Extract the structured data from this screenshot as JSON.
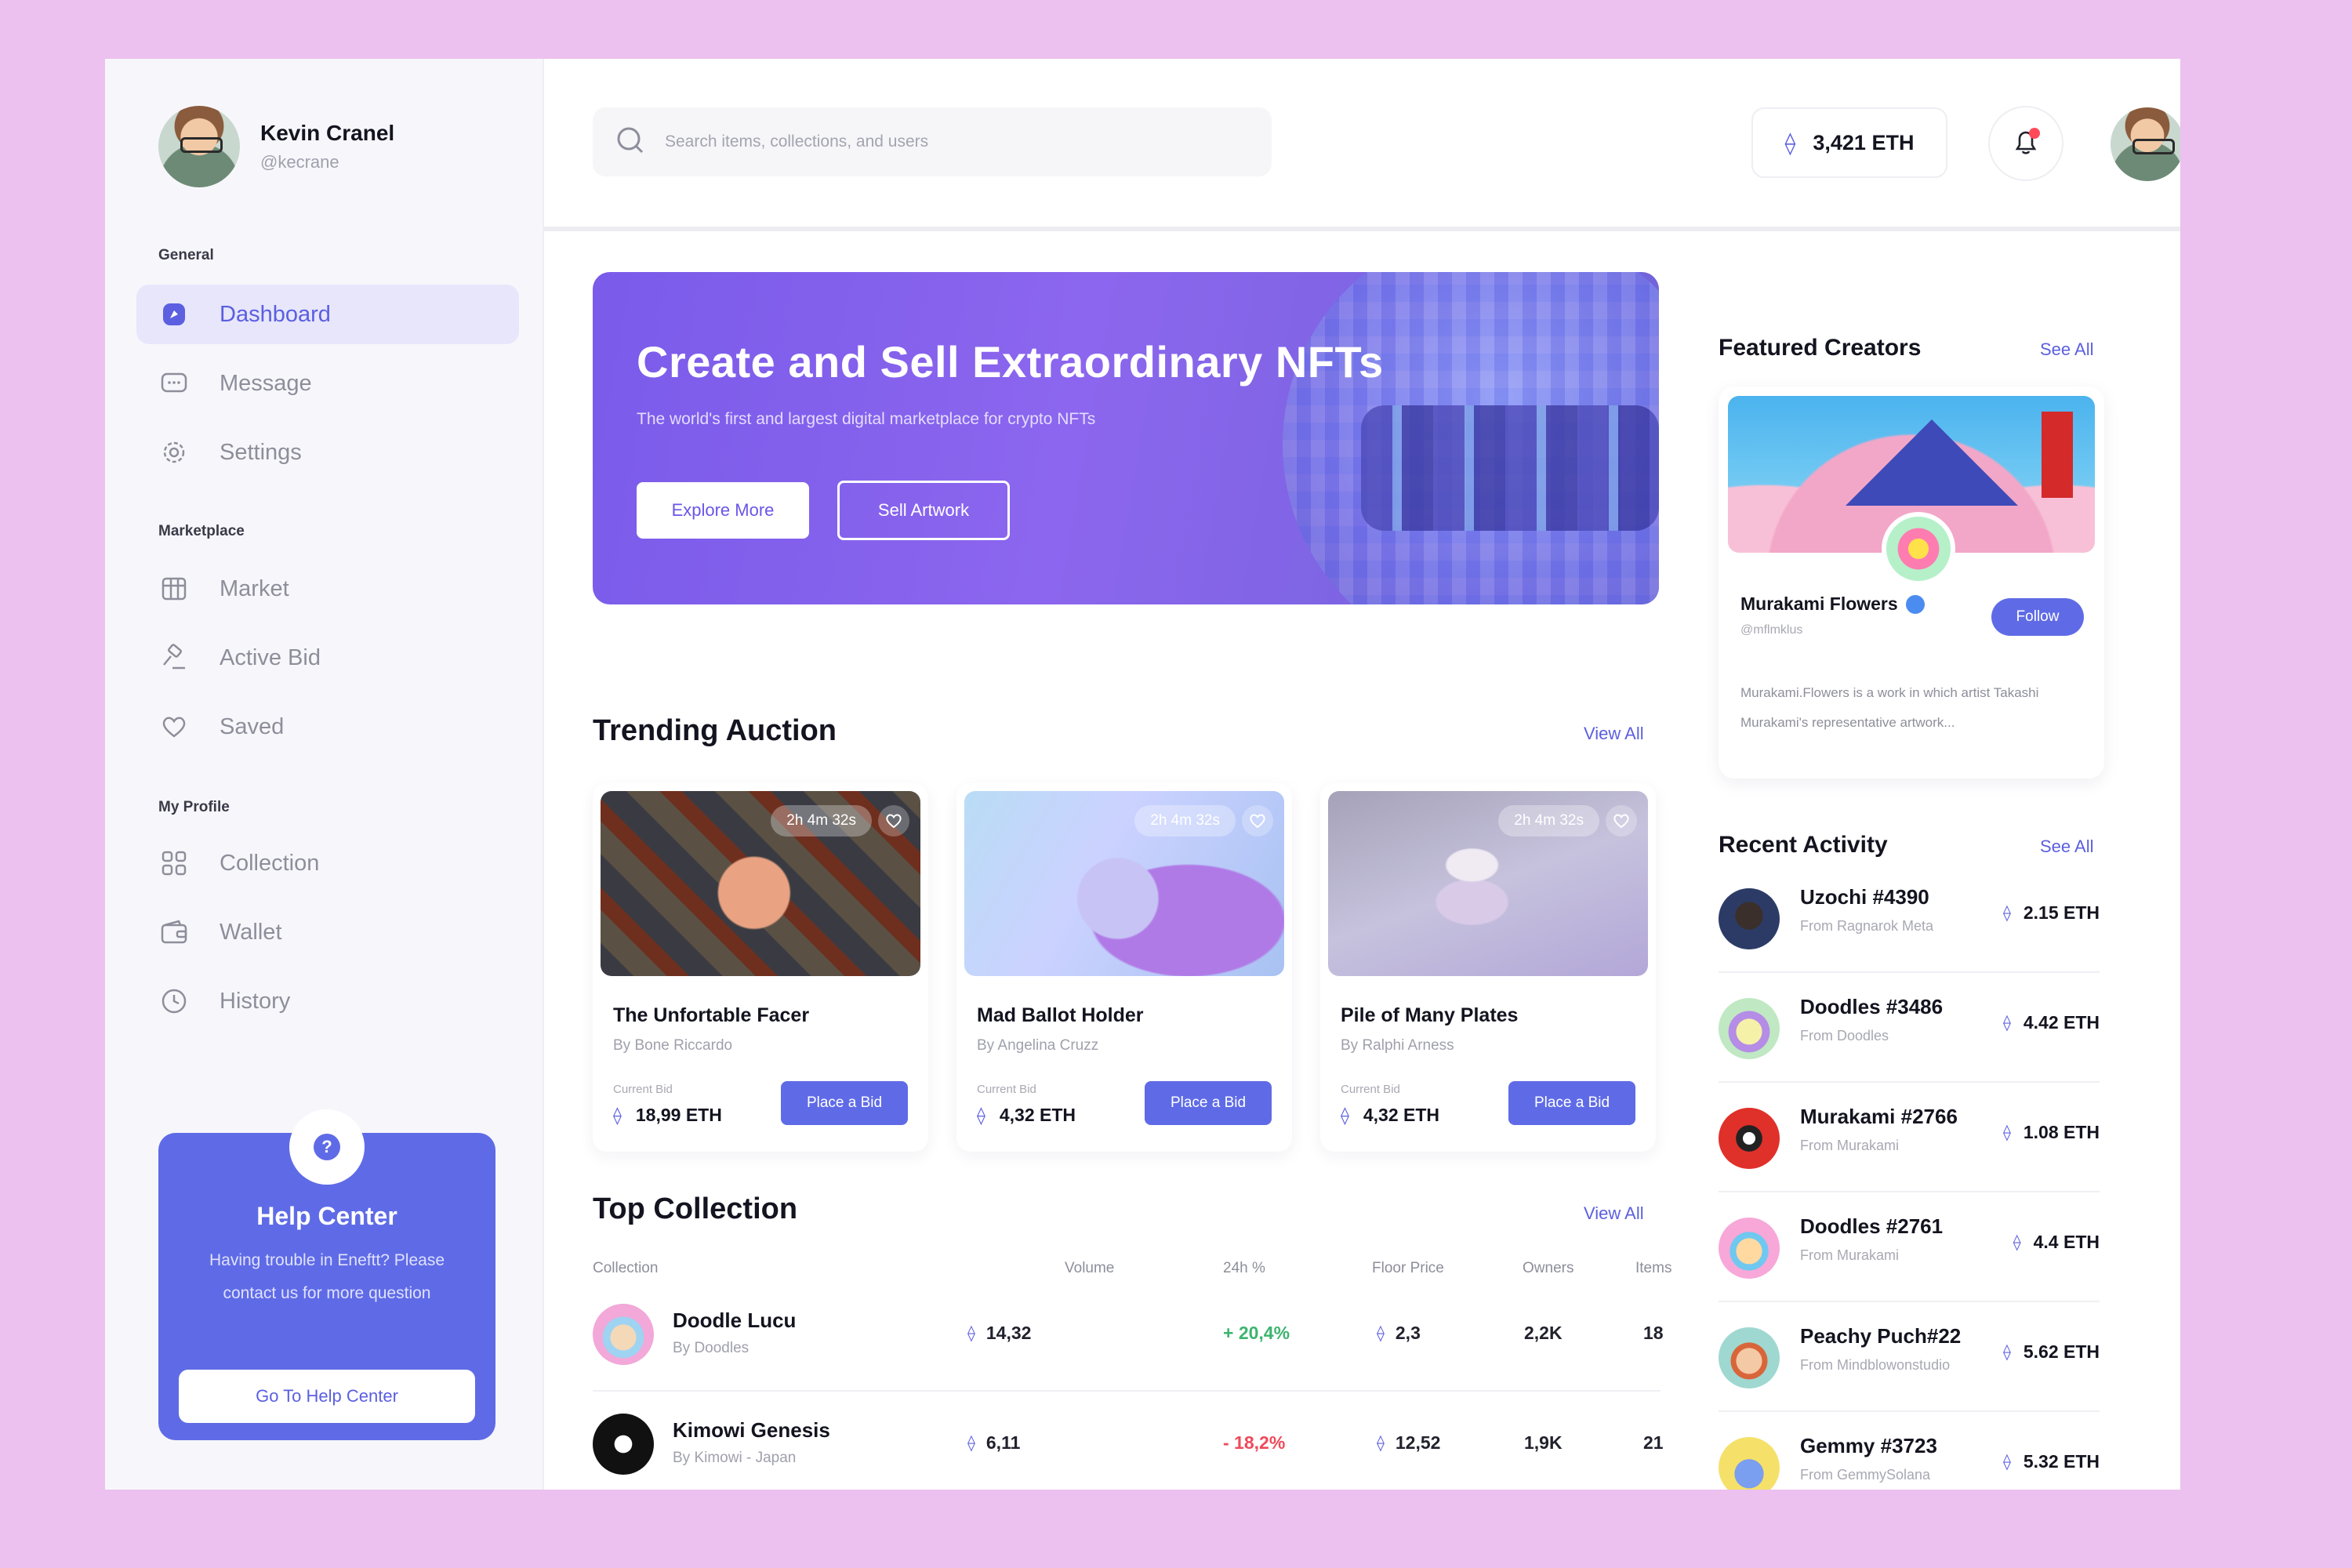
{
  "user": {
    "name": "Kevin Cranel",
    "handle": "@kecrane"
  },
  "sidebar": {
    "sections": [
      "General",
      "Marketplace",
      "My Profile"
    ],
    "items": [
      {
        "label": "Dashboard",
        "icon": "dashboard-icon",
        "active": true
      },
      {
        "label": "Message",
        "icon": "message-icon"
      },
      {
        "label": "Settings",
        "icon": "settings-icon"
      },
      {
        "label": "Market",
        "icon": "market-icon"
      },
      {
        "label": "Active Bid",
        "icon": "active-bid-icon"
      },
      {
        "label": "Saved",
        "icon": "heart-icon"
      },
      {
        "label": "Collection",
        "icon": "collection-icon"
      },
      {
        "label": "Wallet",
        "icon": "wallet-icon"
      },
      {
        "label": "History",
        "icon": "clock-icon"
      }
    ]
  },
  "help": {
    "title": "Help Center",
    "text": "Having trouble in Eneftt? Please contact us for more question",
    "button": "Go To Help Center",
    "icon": "question-icon"
  },
  "topbar": {
    "search_placeholder": "Search items, collections, and users",
    "balance": "3,421 ETH"
  },
  "banner": {
    "title": "Create and Sell Extraordinary NFTs",
    "subtitle": "The world's first and largest digital marketplace for crypto NFTs",
    "primary_button": "Explore More",
    "secondary_button": "Sell Artwork"
  },
  "trending": {
    "title": "Trending Auction",
    "view_all": "View All",
    "bid_label": "Current Bid",
    "bid_button": "Place a Bid",
    "items": [
      {
        "name": "The Unfortable Facer",
        "by": "By Bone Riccardo",
        "timer": "2h 4m 32s",
        "bid": "18,99 ETH"
      },
      {
        "name": "Mad Ballot Holder",
        "by": "By Angelina Cruzz",
        "timer": "2h 4m 32s",
        "bid": "4,32 ETH"
      },
      {
        "name": "Pile of Many Plates",
        "by": "By Ralphi Arness",
        "timer": "2h 4m 32s",
        "bid": "4,32 ETH"
      }
    ]
  },
  "collection": {
    "title": "Top Collection",
    "view_all": "View All",
    "headers": [
      "Collection",
      "Volume",
      "24h %",
      "Floor Price",
      "Owners",
      "Items"
    ],
    "rows": [
      {
        "name": "Doodle Lucu",
        "by": "By Doodles",
        "volume": "14,32",
        "change": "+ 20,4%",
        "floor": "2,3",
        "owners": "2,2K",
        "items": "18"
      },
      {
        "name": "Kimowi Genesis",
        "by": "By Kimowi - Japan",
        "volume": "6,11",
        "change": "- 18,2%",
        "floor": "12,52",
        "owners": "1,9K",
        "items": "21"
      }
    ]
  },
  "featured": {
    "title": "Featured Creators",
    "see_all": "See All",
    "name": "Murakami Flowers",
    "handle": "@mflmklus",
    "follow": "Follow",
    "desc": "Murakami.Flowers is a work in which artist Takashi Murakami's representative artwork..."
  },
  "activity": {
    "title": "Recent Activity",
    "see_all": "See All",
    "items": [
      {
        "name": "Uzochi #4390",
        "from": "From Ragnarok Meta",
        "price": "2.15 ETH"
      },
      {
        "name": "Doodles #3486",
        "from": "From Doodles",
        "price": "4.42 ETH"
      },
      {
        "name": "Murakami #2766",
        "from": "From Murakami",
        "price": "1.08 ETH"
      },
      {
        "name": "Doodles #2761",
        "from": "From Murakami",
        "price": "4.4 ETH"
      },
      {
        "name": "Peachy Puch#22",
        "from": "From Mindblowonstudio",
        "price": "5.62 ETH"
      },
      {
        "name": "Gemmy #3723",
        "from": "From GemmySolana",
        "price": "5.32 ETH"
      }
    ]
  },
  "colors": {
    "accent": "#5f6be6",
    "background": "#ecc0ef",
    "positive": "#3cb46e",
    "negative": "#ef4a5a"
  }
}
